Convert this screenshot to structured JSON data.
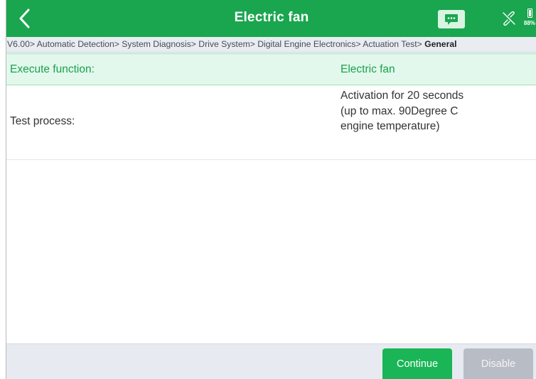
{
  "header": {
    "title": "Electric fan",
    "back_icon": "chevron-left-icon",
    "message_icon": "chat-bubble-icon",
    "link_icon": "broken-link-icon",
    "battery_percent": "88%"
  },
  "breadcrumb": {
    "path": "V6.00> Automatic Detection> System Diagnosis> Drive System> Digital Engine Electronics> Actuation Test> ",
    "current": "General"
  },
  "table": {
    "header": {
      "label": "Execute function:",
      "value": "Electric fan"
    },
    "rows": [
      {
        "label": "Test process:",
        "value": "Activation for 20 seconds (up to max. 90Degree C engine temperature)"
      }
    ]
  },
  "footer": {
    "continue_label": "Continue",
    "disable_label": "Disable"
  },
  "colors": {
    "brand_green": "#19a64f",
    "button_green": "#1ab556",
    "disabled_gray": "#b8bcc4",
    "header_row_bg": "#e2f8ec"
  }
}
